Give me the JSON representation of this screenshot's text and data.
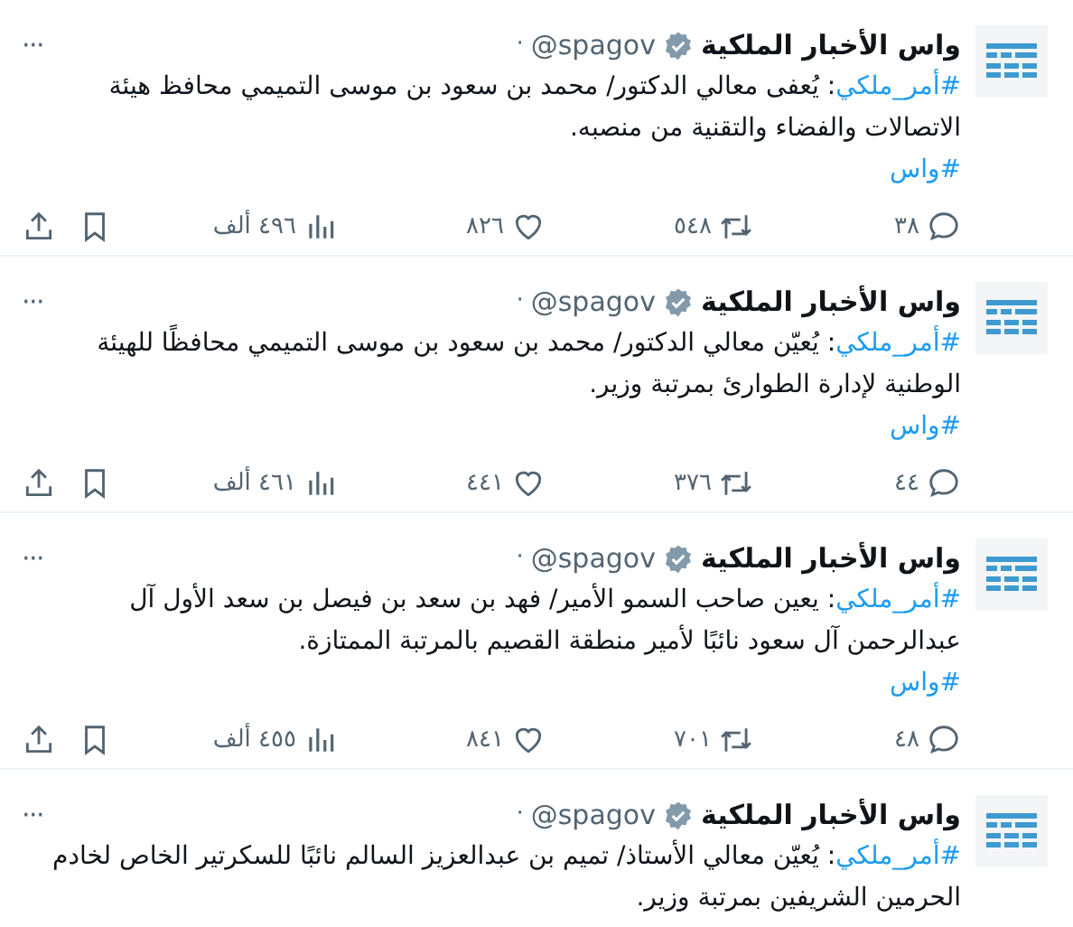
{
  "tweets": [
    {
      "name": "واس الأخبار الملكية",
      "handle": "@spagov",
      "dot": "·",
      "hashtag": "#أمر_ملكي",
      "text": ": يُعفى معالي الدكتور/ محمد بن سعود بن موسى التميمي محافظ هيئة الاتصالات والفضاء والتقنية من منصبه.",
      "tag2": "#واس",
      "more": "···",
      "replies": "٣٨",
      "retweets": "٥٤٨",
      "likes": "٨٢٦",
      "views": "٤٩٦ ألف"
    },
    {
      "name": "واس الأخبار الملكية",
      "handle": "@spagov",
      "dot": "·",
      "hashtag": "#أمر_ملكي",
      "text": ": يُعيّن معالي الدكتور/ محمد بن سعود بن موسى التميمي محافظًا للهيئة الوطنية لإدارة الطوارئ بمرتبة وزير.",
      "tag2": "#واس",
      "more": "···",
      "replies": "٤٤",
      "retweets": "٣٧٦",
      "likes": "٤٤١",
      "views": "٤٦١ ألف"
    },
    {
      "name": "واس الأخبار الملكية",
      "handle": "@spagov",
      "dot": "·",
      "hashtag": "#أمر_ملكي",
      "text": ": يعين صاحب السمو الأمير/ فهد بن سعد بن فيصل بن سعد الأول آل عبدالرحمن آل سعود نائبًا لأمير منطقة القصيم بالمرتبة الممتازة.",
      "tag2": "#واس",
      "more": "···",
      "replies": "٤٨",
      "retweets": "٧٠١",
      "likes": "٨٤١",
      "views": "٤٥٥ ألف"
    },
    {
      "name": "واس الأخبار الملكية",
      "handle": "@spagov",
      "dot": "·",
      "hashtag": "#أمر_ملكي",
      "text": ":  يُعيّن معالي الأستاذ/ تميم بن عبدالعزيز السالم نائبًا للسكرتير الخاص لخادم الحرمين الشريفين بمرتبة وزير.",
      "more": "···"
    }
  ]
}
